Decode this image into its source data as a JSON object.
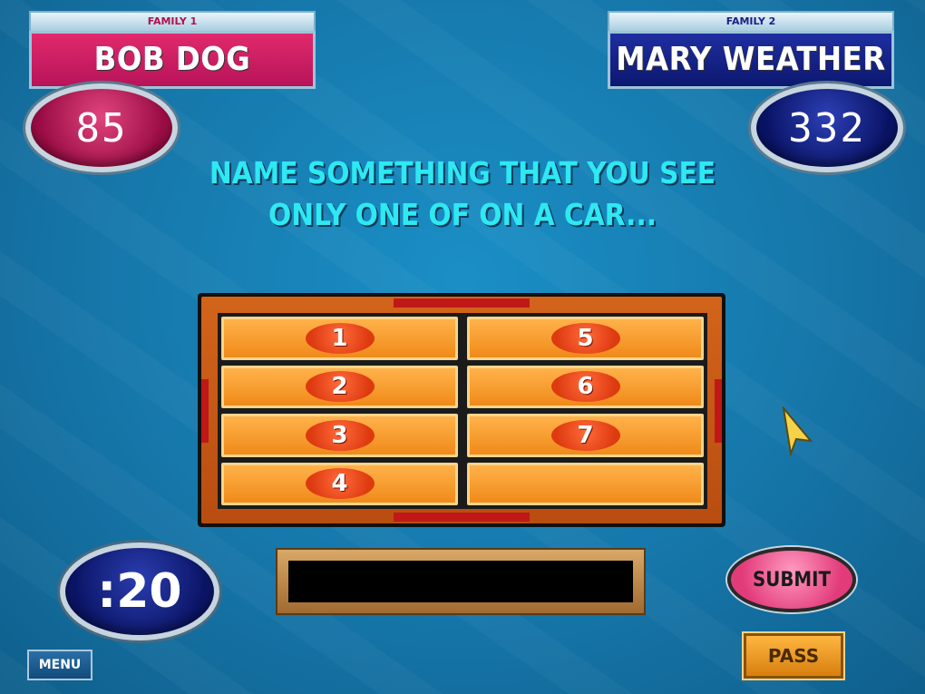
{
  "family1": {
    "tag": "FAMILY 1",
    "name": "BOB DOG",
    "score": "85"
  },
  "family2": {
    "tag": "FAMILY 2",
    "name": "MARY WEATHER",
    "score": "332"
  },
  "question": {
    "line1": "NAME SOMETHING THAT YOU SEE",
    "line2": "ONLY ONE OF ON A CAR..."
  },
  "board": {
    "slots": [
      {
        "number": "1"
      },
      {
        "number": "5"
      },
      {
        "number": "2"
      },
      {
        "number": "6"
      },
      {
        "number": "3"
      },
      {
        "number": "7"
      },
      {
        "number": "4"
      },
      {
        "number": ""
      }
    ]
  },
  "timer": ":20",
  "answer": {
    "value": "",
    "placeholder": ""
  },
  "buttons": {
    "submit": "SUBMIT",
    "pass": "PASS",
    "menu": "MENU"
  },
  "colors": {
    "family1": "#c8185c",
    "family2": "#1a2590",
    "question": "#2ee8f2",
    "board_tile": "#f59a2a",
    "background": "#1677aa"
  },
  "icons": {
    "cursor": "pointer-arrow-icon"
  }
}
